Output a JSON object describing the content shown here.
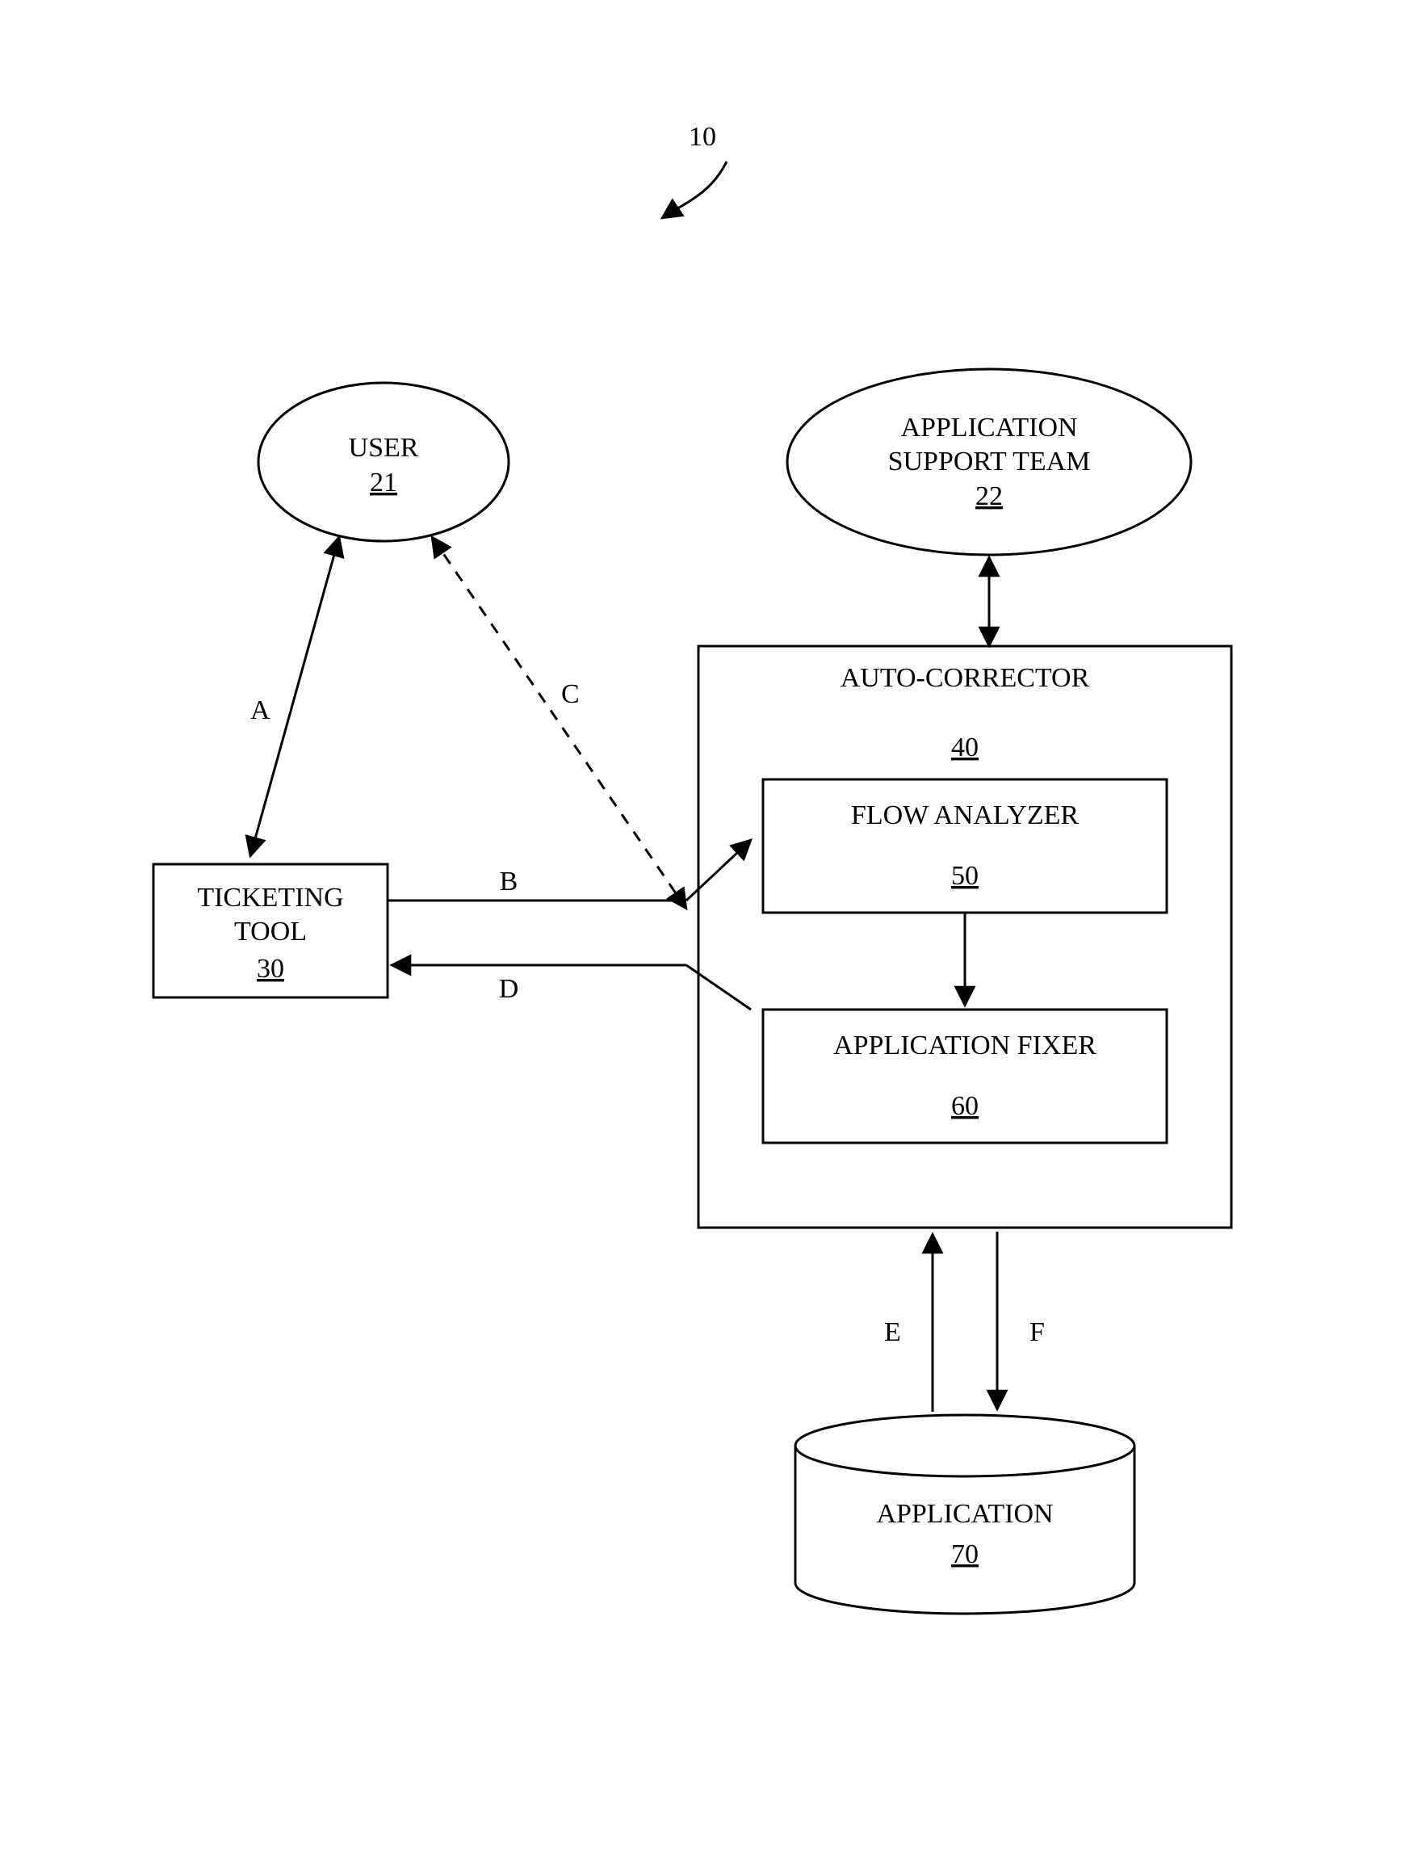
{
  "figure_ref": "10",
  "nodes": {
    "user": {
      "label": "USER",
      "num": "21"
    },
    "support": {
      "label1": "APPLICATION",
      "label2": "SUPPORT TEAM",
      "num": "22"
    },
    "ticket": {
      "label1": "TICKETING",
      "label2": "TOOL",
      "num": "30"
    },
    "autocorr": {
      "label": "AUTO-CORRECTOR",
      "num": "40"
    },
    "flow": {
      "label": "FLOW ANALYZER",
      "num": "50"
    },
    "fixer": {
      "label": "APPLICATION FIXER",
      "num": "60"
    },
    "app": {
      "label": "APPLICATION",
      "num": "70"
    }
  },
  "edges": {
    "A": "A",
    "B": "B",
    "C": "C",
    "D": "D",
    "E": "E",
    "F": "F"
  }
}
